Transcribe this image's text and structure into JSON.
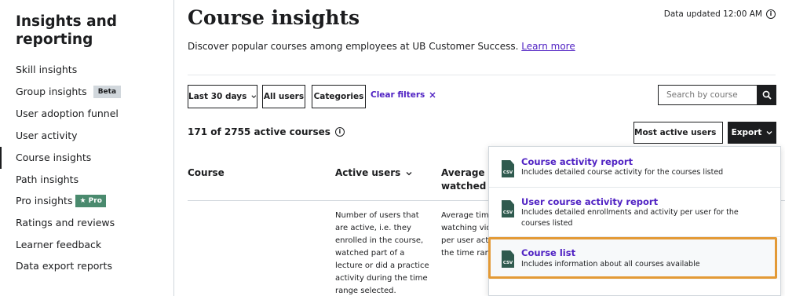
{
  "sidebar": {
    "title": "Insights and reporting",
    "items": [
      {
        "label": "Skill insights"
      },
      {
        "label": "Group insights",
        "badge": "Beta"
      },
      {
        "label": "User adoption funnel"
      },
      {
        "label": "User activity"
      },
      {
        "label": "Course insights",
        "active": true
      },
      {
        "label": "Path insights"
      },
      {
        "label": "Pro insights",
        "badge": "Pro"
      },
      {
        "label": "Ratings and reviews"
      },
      {
        "label": "Learner feedback"
      },
      {
        "label": "Data export reports"
      }
    ]
  },
  "header": {
    "title": "Course insights",
    "data_updated": "Data updated 12:00 AM",
    "subtitle": "Discover popular courses among employees at UB Customer Success.",
    "learn_more": "Learn more"
  },
  "filters": {
    "date_range": "Last 30 days",
    "users": "All users",
    "categories": "Categories",
    "clear": "Clear filters",
    "search_placeholder": "Search by course"
  },
  "results": {
    "count": "171 of 2755 active courses",
    "sort_label": "Most active users",
    "export_label": "Export"
  },
  "table": {
    "columns": [
      {
        "label": "Course"
      },
      {
        "label": "Active users"
      },
      {
        "label": "Average mi",
        "label2": "watched"
      }
    ],
    "descriptions": {
      "active_users": [
        "Number of users that",
        "are active, i.e. they",
        "enrolled in the course,",
        "watched part of a",
        "lecture or did a practice",
        "activity during the time",
        "range selected."
      ],
      "avg_minutes": [
        "Average time",
        "watching vide",
        "per user activ",
        "the time rang"
      ]
    }
  },
  "export_menu": {
    "items": [
      {
        "icon": "csv-file-icon",
        "icon_text": "CSV",
        "title": "Course activity report",
        "description": "Includes detailed course activity for the courses listed"
      },
      {
        "icon": "csv-file-icon",
        "icon_text": "CSV",
        "title": "User course activity report",
        "description": "Includes detailed enrollments and activity per user for the courses listed"
      },
      {
        "icon": "csv-file-icon",
        "icon_text": "CSV",
        "title": "Course list",
        "description": "Includes information about all courses available"
      }
    ]
  },
  "colors": {
    "accent": "#5022c3",
    "highlight": "#e39a36",
    "pro_badge": "#4a8a6e",
    "dark": "#1c1d1f"
  }
}
